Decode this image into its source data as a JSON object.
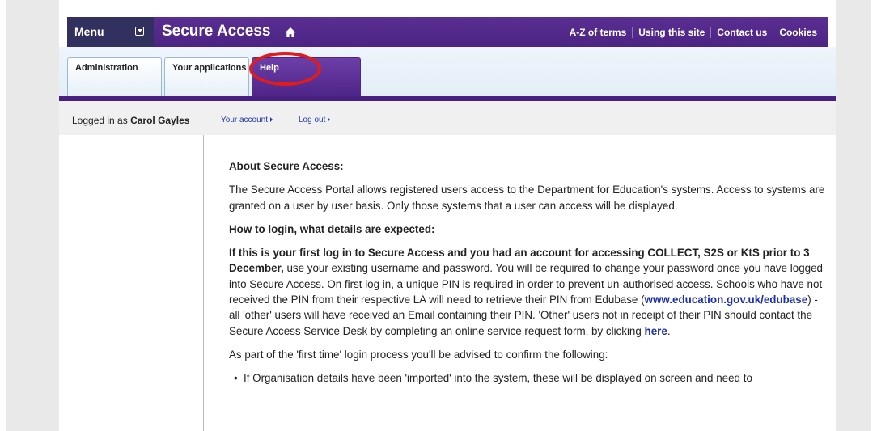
{
  "header": {
    "menu_label": "Menu",
    "site_title": "Secure Access",
    "top_links": [
      "A-Z of terms",
      "Using this site",
      "Contact us",
      "Cookies"
    ]
  },
  "tabs": [
    {
      "label": "Administration"
    },
    {
      "label": "Your applications"
    },
    {
      "label": "Help"
    }
  ],
  "account_bar": {
    "logged_in_prefix": "Logged in as",
    "user_name": "Carol Gayles",
    "your_account": "Your account",
    "log_out": "Log out"
  },
  "content": {
    "about_heading": "About Secure Access:",
    "about_text": "The Secure Access Portal allows registered users access to the Department for Education's systems. Access to systems are granted on a user by user basis. Only those systems that a user can access will be displayed.",
    "login_heading": "How to login, what details are expected:",
    "first_login_bold": "If this is your first log in to Secure Access and you had an account for accessing COLLECT, S2S or KtS prior to 3 December,",
    "first_login_text_1": " use your existing username and password. You will be required to change your password once you have logged into Secure Access. On first log in, a unique PIN is required in order to prevent un-authorised access. Schools who have not received the PIN from their respective LA will need to retrieve their PIN from Edubase (",
    "edubase_link": "www.education.gov.uk/edubase",
    "first_login_text_2": ") - all 'other' users will have received an Email containing their PIN. 'Other' users not in receipt of their PIN should contact the Secure Access Service Desk by completing an online service request form, by clicking ",
    "here_link": "here",
    "first_login_text_3": ".",
    "first_time_text": "As part of the 'first time' login process you'll be advised to confirm the following:",
    "bullet_1": "If Organisation details have been 'imported' into the system, these will be displayed on screen and need to"
  },
  "colors": {
    "brand_purple": "#4c2483",
    "menu_navy": "#31305f",
    "highlight_red": "#e21b1b",
    "link_blue": "#1a2eb0"
  }
}
